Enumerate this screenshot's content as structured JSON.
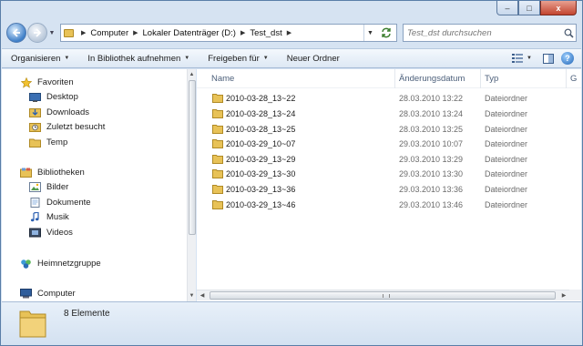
{
  "window": {
    "caption": {
      "minimize": "–",
      "maximize": "□",
      "close": "x"
    }
  },
  "address": {
    "crumbs": [
      "Computer",
      "Lokaler Datenträger (D:)",
      "Test_dst"
    ]
  },
  "search": {
    "placeholder": "Test_dst durchsuchen"
  },
  "commands": {
    "organize": "Organisieren",
    "include_library": "In Bibliothek aufnehmen",
    "share": "Freigeben für",
    "new_folder": "Neuer Ordner",
    "help": "?"
  },
  "nav": {
    "favorites": "Favoriten",
    "desktop": "Desktop",
    "downloads": "Downloads",
    "recent": "Zuletzt besucht",
    "temp": "Temp",
    "libraries": "Bibliotheken",
    "pictures": "Bilder",
    "documents": "Dokumente",
    "music": "Musik",
    "videos": "Videos",
    "homegroup": "Heimnetzgruppe",
    "computer": "Computer"
  },
  "columns": {
    "name": "Name",
    "modified": "Änderungsdatum",
    "type": "Typ",
    "size": "G"
  },
  "files": [
    {
      "name": "2010-03-28_13~22",
      "date": "28.03.2010 13:22",
      "type": "Dateiordner"
    },
    {
      "name": "2010-03-28_13~24",
      "date": "28.03.2010 13:24",
      "type": "Dateiordner"
    },
    {
      "name": "2010-03-28_13~25",
      "date": "28.03.2010 13:25",
      "type": "Dateiordner"
    },
    {
      "name": "2010-03-29_10~07",
      "date": "29.03.2010 10:07",
      "type": "Dateiordner"
    },
    {
      "name": "2010-03-29_13~29",
      "date": "29.03.2010 13:29",
      "type": "Dateiordner"
    },
    {
      "name": "2010-03-29_13~30",
      "date": "29.03.2010 13:30",
      "type": "Dateiordner"
    },
    {
      "name": "2010-03-29_13~36",
      "date": "29.03.2010 13:36",
      "type": "Dateiordner"
    },
    {
      "name": "2010-03-29_13~46",
      "date": "29.03.2010 13:46",
      "type": "Dateiordner"
    }
  ],
  "status": {
    "count": "8 Elemente"
  },
  "colors": {
    "folder": "#e8c257",
    "chrome": "#d6e3f2",
    "header_text": "#4c5f7a"
  }
}
